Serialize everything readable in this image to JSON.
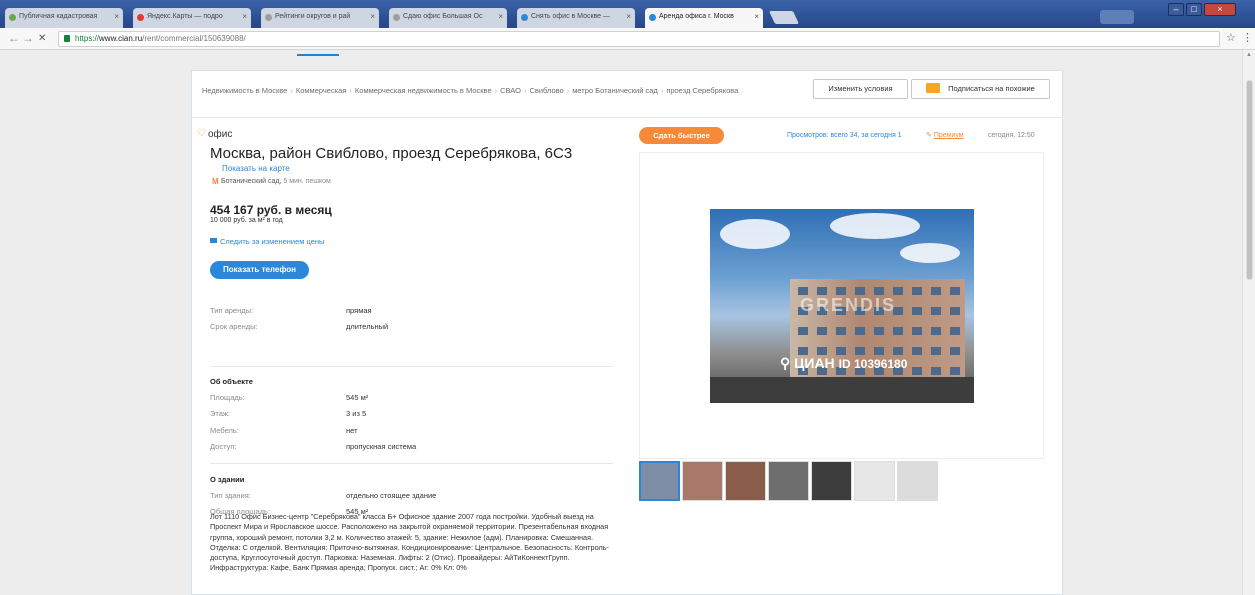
{
  "browser": {
    "tabs": [
      {
        "label": "Публичная кадастровая",
        "fav": "#6aa84f"
      },
      {
        "label": "Яндекс.Карты — подро",
        "fav": "#e53935"
      },
      {
        "label": "Рейтинги округов и рай",
        "fav": "#9e9e9e"
      },
      {
        "label": "Сдаю офис Большая Ос",
        "fav": "#9e9e9e"
      },
      {
        "label": "Снять офис в Москве —",
        "fav": "#2b87db"
      },
      {
        "label": "Аренда офиса г. Москв",
        "fav": "#2b87db"
      }
    ],
    "close_glyph": "×",
    "window_buttons": {
      "minimize": "–",
      "maximize": "□",
      "close": "×"
    },
    "url": {
      "scheme": "https://",
      "host": "www.cian.ru",
      "path": "/rent/commercial/150639088/"
    },
    "nav": {
      "back": "←",
      "forward": "→",
      "reload": "✕"
    },
    "star": "☆",
    "menu": "⋮"
  },
  "breadcrumbs": [
    "Недвижимость в Москве",
    "Коммерческая",
    "Коммерческая недвижимость в Москве",
    "СВАО",
    "Свиблово",
    "метро Ботанический сад",
    "проезд Серебрякова"
  ],
  "breadcrumb_sep": "›",
  "actions": {
    "change_conditions": "Изменить условия",
    "subscribe": "Подписаться на похожие"
  },
  "listing": {
    "type": "офис",
    "title": "Москва, район Свиблово, проезд Серебрякова, 6С3",
    "map_link": "Показать на карте",
    "metro_icon": "М",
    "metro": "Ботанический сад,",
    "walk": "5 мин. пешком",
    "price": "454 167 руб. в месяц",
    "price_sub": "10 000 руб. за м² в год",
    "follow_price": "Следить за изменением цены",
    "show_phone": "Показать телефон"
  },
  "rent_props": [
    {
      "k": "Тип аренды:",
      "v": "прямая"
    },
    {
      "k": "Срок аренды:",
      "v": "длительный"
    }
  ],
  "object_section": {
    "title": "Об объекте",
    "props": [
      {
        "k": "Площадь:",
        "v": "545 м²"
      },
      {
        "k": "Этаж:",
        "v": "3 из 5"
      },
      {
        "k": "Мебель:",
        "v": "нет"
      },
      {
        "k": "Доступ:",
        "v": "пропускная система"
      }
    ]
  },
  "building_section": {
    "title": "О здании",
    "props": [
      {
        "k": "Тип здания:",
        "v": "отдельно стоящее здание"
      },
      {
        "k": "Общая площадь:",
        "v": "545 м²"
      }
    ]
  },
  "description": "Лот 1110 Офис Бизнес-центр \"Серебрякова\" класса Б+ Офисное здание 2007 года постройки. Удобный выезд на Проспект Мира и Ярославское шоссе. Расположено на закрытой охраняемой территории. Презентабельная входная группа, хороший ремонт, потолки 3,2 м. Количество этажей: 5, здание: Нежилое (адм). Планировка: Смешанная. Отделка: С отделкой. Вентиляция: Приточно-вытяжная. Кондиционирование: Центральное. Безопасность: Контроль-доступа, Круглосуточный доступ. Парковка: Наземная. Лифты: 2 (Отис). Провайдеры: АйТиКоннектГрупп. Инфраструктура: Кафе, Банк Прямая аренда; Пропуск. сист.; Аг: 0% Кл: 0%",
  "right": {
    "quick": "Сдать быстрее",
    "views": "Просмотров: всего 34, за сегодня 1",
    "premium": "Премиум",
    "date": "сегодня, 12:50"
  },
  "photo": {
    "watermark": "GRENDIS",
    "cian": "ЦИАН",
    "cian_id": "ID 10396180",
    "pin": "⚲"
  },
  "thumbs": [
    "#7d8ea6",
    "#a8786a",
    "#8a5d4a",
    "#6e6e6e",
    "#3d3d3d",
    "#e7e7e7",
    "#dcdcdc"
  ],
  "colors": {
    "accent": "#2b87db",
    "orange": "#f6893a",
    "premium": "#f6a623"
  }
}
